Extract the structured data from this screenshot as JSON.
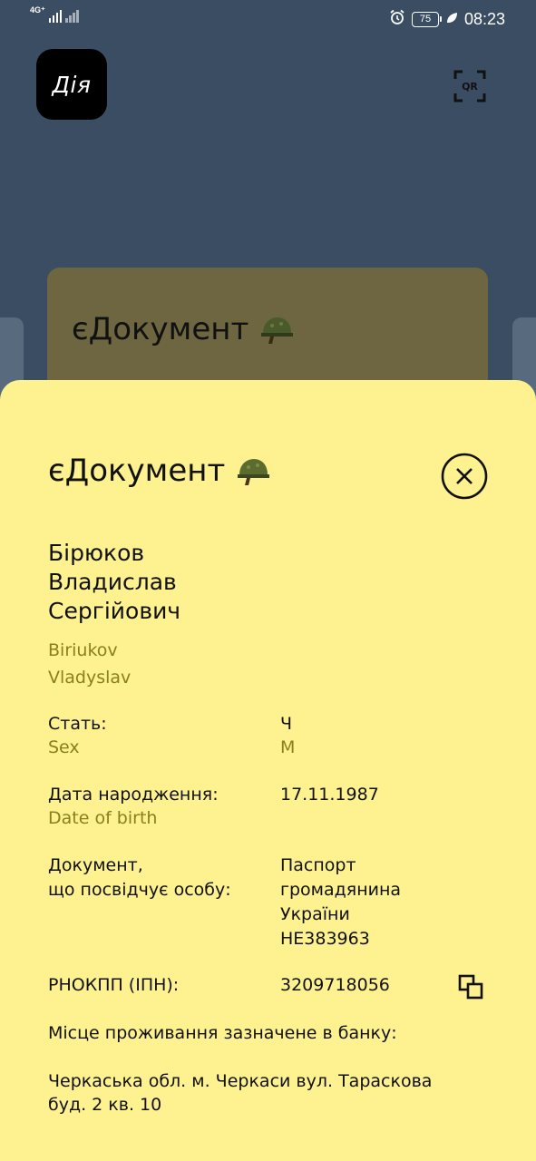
{
  "status_bar": {
    "network": "4G⁺",
    "battery": "75",
    "time": "08:23"
  },
  "header": {
    "logo_text": "Дія",
    "qr_label": "QR"
  },
  "background_card": {
    "title": "єДокумент",
    "icon": "military-helmet-icon"
  },
  "sheet": {
    "title": "єДокумент",
    "title_icon": "military-helmet-icon",
    "close_icon": "close-circle-icon",
    "full_name": [
      "Бірюков",
      "Владислав",
      "Сергійович"
    ],
    "latin_name": [
      "Biriukov",
      "Vladyslav"
    ],
    "sex": {
      "label": "Стать:",
      "label_en": "Sex",
      "value": "Ч",
      "value_en": "M"
    },
    "dob": {
      "label": "Дата народження:",
      "label_en": "Date of birth",
      "value": "17.11.1987"
    },
    "document": {
      "label": [
        "Документ,",
        "що посвідчує особу:"
      ],
      "value": [
        "Паспорт",
        "громадянина",
        "України",
        "НЕ383963"
      ]
    },
    "tax_id": {
      "label": "РНОКПП (ІПН):",
      "value": "3209718056",
      "copy_icon": "copy-icon"
    },
    "address": {
      "label": "Місце проживання зазначене в банку:",
      "value": [
        "Черкаська обл. м. Черкаси вул. Тараскова",
        "буд. 2 кв. 10"
      ]
    }
  },
  "colors": {
    "background": "#3b4d62",
    "sheet": "#fdf190",
    "accent_text": "#8a7f1e",
    "bg_card": "#6d6640"
  }
}
